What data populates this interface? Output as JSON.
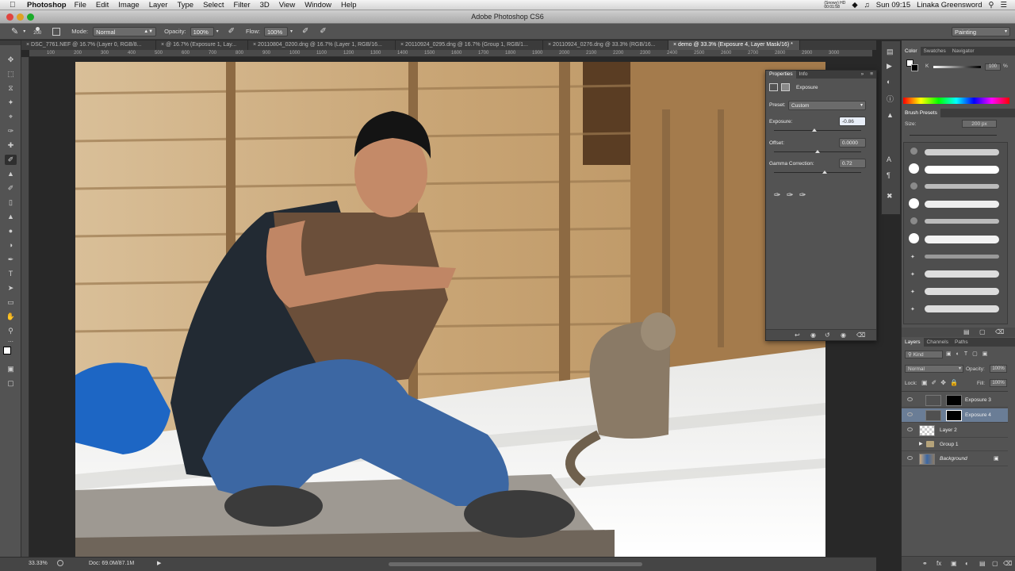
{
  "menubar": {
    "apple": "",
    "app_name": "Photoshop",
    "items": [
      "File",
      "Edit",
      "Image",
      "Layer",
      "Type",
      "Select",
      "Filter",
      "3D",
      "View",
      "Window",
      "Help"
    ],
    "clock": "Sun 09:15",
    "user": "Linaka Greensword",
    "recording": "(Snowy) HD\n00:01:58"
  },
  "window": {
    "title": "Adobe Photoshop CS6"
  },
  "options": {
    "brush_size": "200",
    "mode_label": "Mode:",
    "mode_value": "Normal",
    "opacity_label": "Opacity:",
    "opacity_value": "100%",
    "flow_label": "Flow:",
    "flow_value": "100%",
    "workspace": "Painting"
  },
  "tabs": [
    {
      "label": "DSC_7761.NEF @ 16.7% (Layer 0, RGB/8...",
      "active": false
    },
    {
      "label": "@ 16.7% (Exposure 1, Lay...",
      "active": false
    },
    {
      "label": "20110804_0200.dng @ 16.7% (Layer 1, RGB/16...",
      "active": false
    },
    {
      "label": "20110924_0295.dng @ 16.7% (Group 1, RGB/1...",
      "active": false
    },
    {
      "label": "20110924_0276.dng @ 33.3% (RGB/16...",
      "active": false
    },
    {
      "label": "demo @ 33.3% (Exposure 4, Layer Mask/16) *",
      "active": true
    }
  ],
  "ruler_ticks": [
    "100",
    "200",
    "300",
    "400",
    "500",
    "600",
    "700",
    "800",
    "900",
    "1000",
    "1100",
    "1200",
    "1300",
    "1400",
    "1500",
    "1600",
    "1700",
    "1800",
    "1900",
    "2000",
    "2100",
    "2200",
    "2300",
    "2400",
    "2500",
    "2600",
    "2700",
    "2800",
    "2900",
    "3000"
  ],
  "status": {
    "zoom": "33.33%",
    "doc": "Doc: 69.0M/87.1M"
  },
  "properties": {
    "tab_properties": "Properties",
    "tab_info": "Info",
    "title": "Exposure",
    "preset_label": "Preset:",
    "preset_value": "Custom",
    "exposure_label": "Exposure:",
    "exposure_value": "-0.86",
    "exposure_level": 0.46,
    "offset_label": "Offset:",
    "offset_value": "0.0000",
    "offset_level": 0.5,
    "gamma_label": "Gamma Correction:",
    "gamma_value": "0.72",
    "gamma_level": 0.58
  },
  "color_panel": {
    "tabs": [
      "Color",
      "Swatches",
      "Navigator"
    ],
    "channel": "K",
    "value": "100",
    "unit": "%"
  },
  "brush_panel": {
    "title": "Brush Presets",
    "size_label": "Size:",
    "size_value": "200 px"
  },
  "layers_panel": {
    "tabs": [
      "Layers",
      "Channels",
      "Paths"
    ],
    "kind": "Kind",
    "blend": "Normal",
    "opacity_label": "Opacity:",
    "opacity_value": "100%",
    "lock_label": "Lock:",
    "fill_label": "Fill:",
    "fill_value": "100%",
    "layers": [
      {
        "name": "Exposure 3",
        "selected": false
      },
      {
        "name": "Exposure 4",
        "selected": true
      },
      {
        "name": "Layer 2",
        "selected": false
      },
      {
        "name": "Group 1",
        "selected": false
      },
      {
        "name": "Background",
        "selected": false
      }
    ]
  },
  "icons": [
    "apple-icon",
    "brush-tool-icon",
    "eyedropper-icon",
    "lock-icon",
    "eye-icon",
    "folder-icon",
    "trash-icon"
  ]
}
